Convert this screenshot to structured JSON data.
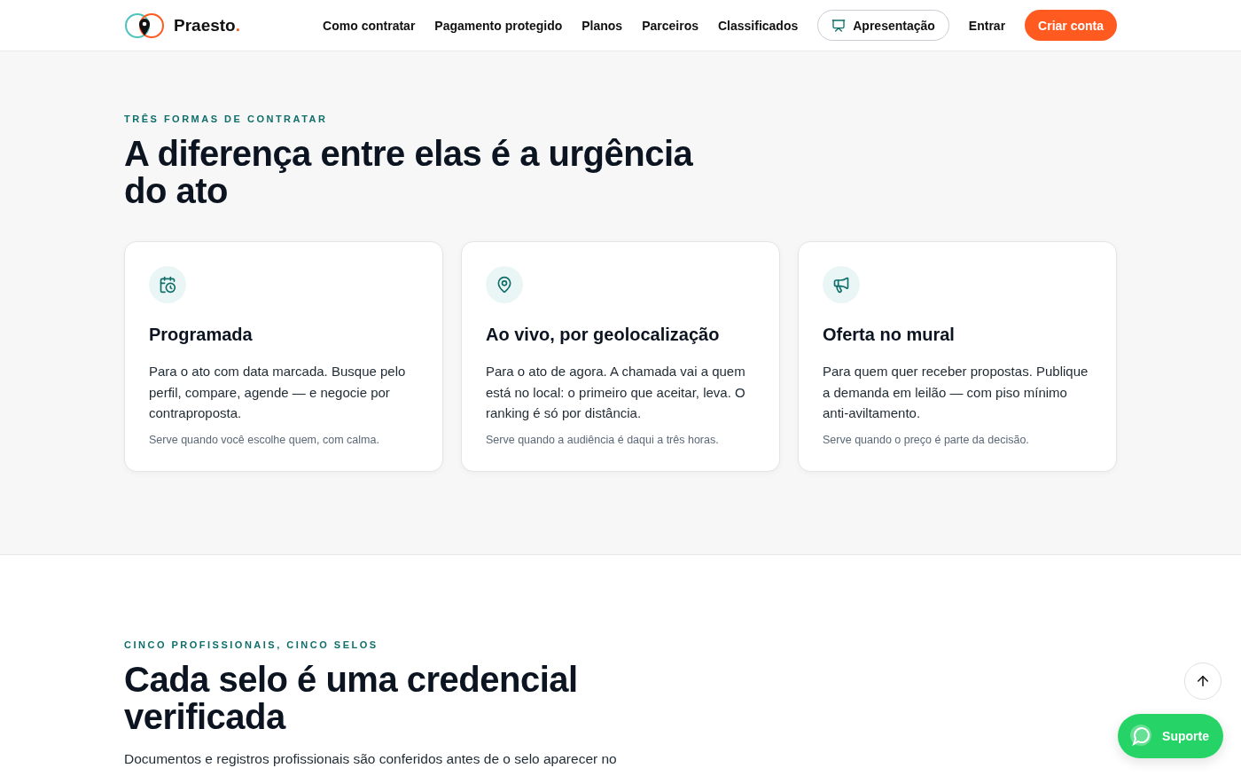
{
  "brand": {
    "name": "Praesto",
    "mark": "."
  },
  "nav": {
    "links": [
      "Como contratar",
      "Pagamento protegido",
      "Planos",
      "Parceiros",
      "Classificados"
    ],
    "presentation": "Apresentação",
    "login": "Entrar",
    "signup": "Criar conta"
  },
  "section_1": {
    "eyebrow": "TRÊS FORMAS DE CONTRATAR",
    "title": "A diferença entre elas é a urgência do ato",
    "cards": [
      {
        "title": "Programada",
        "text": "Para o ato com data marcada. Busque pelo perfil, compare, agende — e negocie por contraproposta.",
        "note": "Serve quando você escolhe quem, com calma."
      },
      {
        "title": "Ao vivo, por geolocalização",
        "text": "Para o ato de agora. A chamada vai a quem está no local: o primeiro que aceitar, leva. O ranking é só por distância.",
        "note": "Serve quando a audiência é daqui a três horas."
      },
      {
        "title": "Oferta no mural",
        "text": "Para quem quer receber propostas. Publique a demanda em leilão — com piso mínimo anti-aviltamento.",
        "note": "Serve quando o preço é parte da decisão."
      }
    ]
  },
  "section_2": {
    "eyebrow": "CINCO PROFISSIONAIS, CINCO SELOS",
    "title": "Cada selo é uma credencial verificada",
    "text": "Documentos e registros profissionais são conferidos antes de o selo aparecer no"
  },
  "support": {
    "label": "Suporte"
  }
}
